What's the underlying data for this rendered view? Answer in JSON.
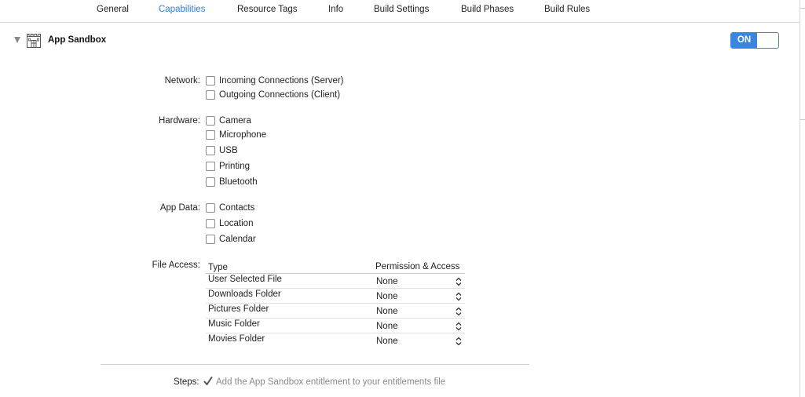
{
  "tabs": [
    {
      "label": "General",
      "active": false
    },
    {
      "label": "Capabilities",
      "active": true
    },
    {
      "label": "Resource Tags",
      "active": false
    },
    {
      "label": "Info",
      "active": false
    },
    {
      "label": "Build Settings",
      "active": false
    },
    {
      "label": "Build Phases",
      "active": false
    },
    {
      "label": "Build Rules",
      "active": false
    }
  ],
  "section": {
    "title": "App Sandbox",
    "toggle_label": "ON",
    "icon": "sandbox-castle-icon",
    "expanded": true
  },
  "network": {
    "label": "Network:",
    "options": [
      {
        "label": "Incoming Connections (Server)",
        "checked": false
      },
      {
        "label": "Outgoing Connections (Client)",
        "checked": false
      }
    ]
  },
  "hardware": {
    "label": "Hardware:",
    "options": [
      {
        "label": "Camera",
        "checked": false
      },
      {
        "label": "Microphone",
        "checked": false
      },
      {
        "label": "USB",
        "checked": false
      },
      {
        "label": "Printing",
        "checked": false
      },
      {
        "label": "Bluetooth",
        "checked": false
      }
    ]
  },
  "app_data": {
    "label": "App Data:",
    "options": [
      {
        "label": "Contacts",
        "checked": false
      },
      {
        "label": "Location",
        "checked": false
      },
      {
        "label": "Calendar",
        "checked": false
      }
    ]
  },
  "file_access": {
    "label": "File Access:",
    "columns": [
      "Type",
      "Permission & Access"
    ],
    "rows": [
      {
        "type": "User Selected File",
        "permission": "None"
      },
      {
        "type": "Downloads Folder",
        "permission": "None"
      },
      {
        "type": "Pictures Folder",
        "permission": "None"
      },
      {
        "type": "Music Folder",
        "permission": "None"
      },
      {
        "type": "Movies Folder",
        "permission": "None"
      }
    ]
  },
  "steps": {
    "label": "Steps:",
    "icon": "checkmark-icon",
    "text": "Add the App Sandbox entitlement to your entitlements file"
  },
  "colors": {
    "accent": "#3a86df",
    "active_tab": "#2f7fd8",
    "muted_text": "#8a8a8a"
  }
}
